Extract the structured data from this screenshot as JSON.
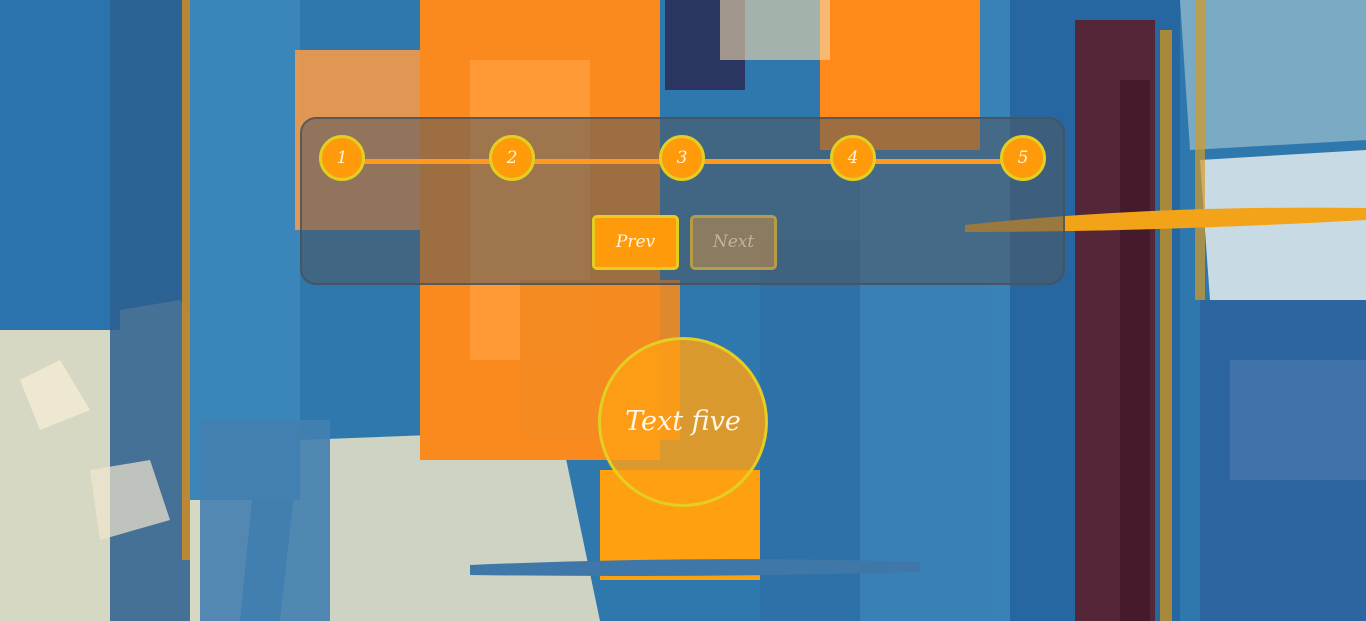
{
  "stepper": {
    "steps": [
      {
        "label": "1"
      },
      {
        "label": "2"
      },
      {
        "label": "3"
      },
      {
        "label": "4"
      },
      {
        "label": "5"
      }
    ],
    "active_step": 5,
    "prev_label": "Prev",
    "next_label": "Next",
    "next_disabled": true
  },
  "content": {
    "text": "Text five"
  },
  "colors": {
    "accent": "#ff9a0a",
    "border": "#e3cf21",
    "panel": "#50585f",
    "text": "#fff4dc"
  }
}
